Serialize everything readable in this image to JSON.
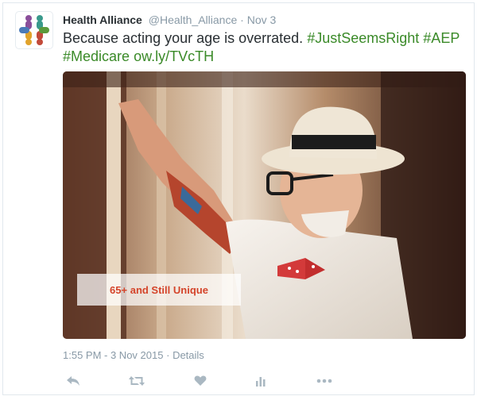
{
  "tweet": {
    "author_name": "Health Alliance",
    "author_handle": "@Health_Alliance",
    "separator": "·",
    "date_short": "Nov 3",
    "text_main": "Because acting your age is overrated.",
    "hashtag_1": "#JustSeemsRight",
    "hashtag_2": "#AEP",
    "hashtag_3": "#Medicare",
    "link": "ow.ly/TVcTH",
    "timestamp": "1:55 PM - 3 Nov 2015",
    "details_label": "Details"
  },
  "media": {
    "overlay_text": "65+ and Still Unique"
  },
  "actions": {
    "reply": "reply-icon",
    "retweet": "retweet-icon",
    "like": "heart-icon",
    "analytics": "analytics-icon",
    "more": "more-icon"
  },
  "colors": {
    "hashtag": "#3a8a28",
    "overlay_text": "#d4442a",
    "muted": "#8899a6"
  }
}
